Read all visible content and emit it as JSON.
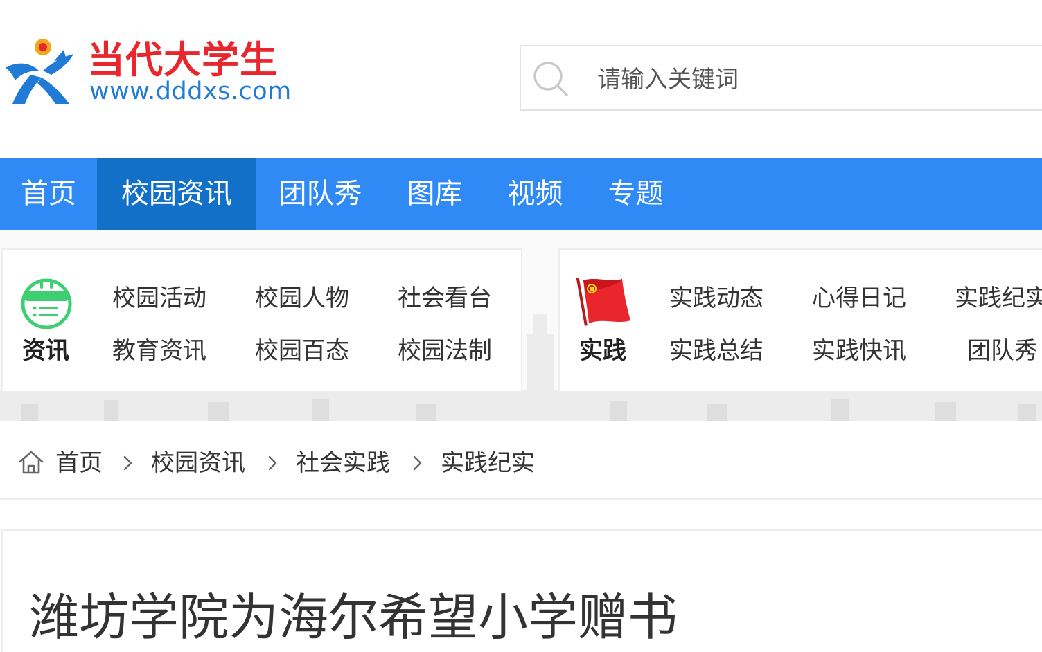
{
  "site": {
    "logo_cn": "当代大学生",
    "logo_url": "www.dddxs.com"
  },
  "search": {
    "placeholder": "请输入关键词"
  },
  "nav": {
    "items": [
      {
        "label": "首页"
      },
      {
        "label": "校园资讯",
        "active": true
      },
      {
        "label": "团队秀"
      },
      {
        "label": "图库"
      },
      {
        "label": "视频"
      },
      {
        "label": "专题"
      }
    ]
  },
  "categories": {
    "news": {
      "title": "资讯",
      "icon": "calendar-icon",
      "links": [
        "校园活动",
        "校园人物",
        "社会看台",
        "教育资讯",
        "校园百态",
        "校园法制"
      ]
    },
    "practice": {
      "title": "实践",
      "icon": "red-flag-icon",
      "links": [
        "实践动态",
        "心得日记",
        "实践纪实",
        "实践总结",
        "实践快讯",
        "团队秀"
      ]
    }
  },
  "breadcrumb": {
    "items": [
      "首页",
      "校园资讯",
      "社会实践",
      "实践纪实"
    ]
  },
  "article": {
    "title": "潍坊学院为海尔希望小学赠书"
  },
  "colors": {
    "nav_bg": "#2f8af5",
    "nav_active": "#1270c9",
    "logo_red": "#e8262c",
    "logo_blue": "#1f7bd6",
    "icon_green": "#3fcf73"
  }
}
